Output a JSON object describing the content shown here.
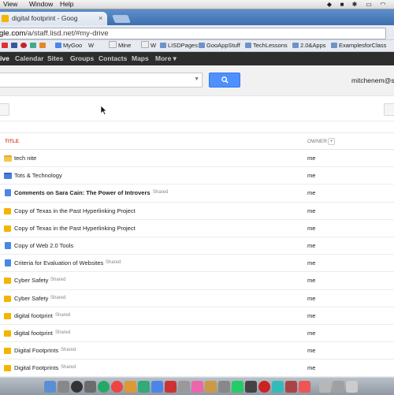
{
  "menubar": {
    "items": [
      "View",
      "Window",
      "Help"
    ]
  },
  "browser": {
    "tab_title": "digital footprint - Goog",
    "url_host": "gle.com",
    "url_path": "/a/staff.lisd.net/#my-drive"
  },
  "bookmarks": [
    "MyGoo",
    "W",
    "Mine",
    "W",
    "LISDPages",
    "GooAppStuff",
    "TechLessons",
    "2.0&Apps",
    "ExamplesforClass"
  ],
  "gbar": [
    "ive",
    "Calendar",
    "Sites",
    "Groups",
    "Contacts",
    "Maps",
    "More ▾"
  ],
  "user": {
    "email": "mitchenem@staf"
  },
  "list": {
    "title_header": "TITLE",
    "owner_header": "OWNER",
    "rows": [
      {
        "name": "tech nite",
        "icon": "folder-yellow",
        "shared": "",
        "owner": "me",
        "bold": false
      },
      {
        "name": "Tots & Technology",
        "icon": "folder-blue",
        "shared": "",
        "owner": "me",
        "bold": false
      },
      {
        "name": "Comments on Sara Cain: The Power of Introvers",
        "icon": "doc",
        "shared": "Shared",
        "owner": "me",
        "bold": true
      },
      {
        "name": "Copy of Texas in the Past Hyperlinking Project",
        "icon": "pres",
        "shared": "",
        "owner": "me",
        "bold": false
      },
      {
        "name": "Copy of Texas in the Past Hyperlinking Project",
        "icon": "pres",
        "shared": "",
        "owner": "me",
        "bold": false
      },
      {
        "name": "Copy of Web 2.0 Tools",
        "icon": "doc",
        "shared": "",
        "owner": "me",
        "bold": false
      },
      {
        "name": "Criteria for Evaluation of Websites",
        "icon": "doc",
        "shared": "Shared",
        "owner": "me",
        "bold": false
      },
      {
        "name": "Cyber Safety",
        "icon": "pres",
        "shared": "Shared",
        "owner": "me",
        "bold": false
      },
      {
        "name": "Cyber Safety",
        "icon": "pres",
        "shared": "Shared",
        "owner": "me",
        "bold": false
      },
      {
        "name": "digital footprint",
        "icon": "pres",
        "shared": "Shared",
        "owner": "me",
        "bold": false
      },
      {
        "name": "digital footprint",
        "icon": "pres",
        "shared": "Shared",
        "owner": "me",
        "bold": false
      },
      {
        "name": "Digital Footprints",
        "icon": "pres",
        "shared": "Shared",
        "owner": "me",
        "bold": false
      },
      {
        "name": "Digital Footprints",
        "icon": "pres",
        "shared": "Shared",
        "owner": "me",
        "bold": false
      }
    ]
  },
  "colors": {
    "accent": "#4d90fe",
    "title_header": "#dd4b39",
    "gbar": "#2d2d2d"
  }
}
